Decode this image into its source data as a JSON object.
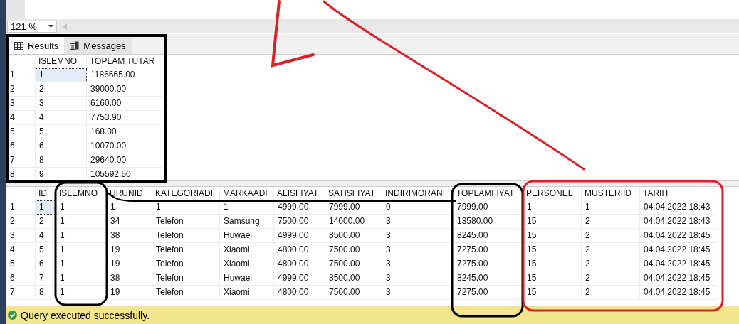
{
  "zoom": {
    "value": "121 %"
  },
  "tabs": [
    {
      "label": "Results",
      "selected": true
    },
    {
      "label": "Messages",
      "selected": false
    }
  ],
  "grid_1": {
    "columns": [
      "ISLEMNO",
      "TOPLAM TUTAR"
    ],
    "rows": [
      {
        "num": "1",
        "selected": true,
        "cells": [
          "1",
          "1186665.00"
        ]
      },
      {
        "num": "2",
        "selected": false,
        "cells": [
          "2",
          "39000.00"
        ]
      },
      {
        "num": "3",
        "selected": false,
        "cells": [
          "3",
          "6160.00"
        ]
      },
      {
        "num": "4",
        "selected": false,
        "cells": [
          "4",
          "7753.90"
        ]
      },
      {
        "num": "5",
        "selected": false,
        "cells": [
          "5",
          "168.00"
        ]
      },
      {
        "num": "6",
        "selected": false,
        "cells": [
          "6",
          "10070.00"
        ]
      },
      {
        "num": "7",
        "selected": false,
        "cells": [
          "8",
          "29640.00"
        ]
      },
      {
        "num": "8",
        "selected": false,
        "cells": [
          "9",
          "105592.50"
        ]
      }
    ]
  },
  "grid_2": {
    "columns": [
      "ID",
      "ISLEMNO",
      "URUNID",
      "KATEGORIADI",
      "MARKAADI",
      "ALISFIYAT",
      "SATISFIYAT",
      "INDIRIMORANI",
      "TOPLAMFIYAT",
      "PERSONEL",
      "MUSTERIID",
      "TARIH"
    ],
    "rows": [
      {
        "num": "1",
        "selected": true,
        "cells": [
          "1",
          "1",
          "1",
          "1",
          "1",
          "4999.00",
          "7999.00",
          "0",
          "7999.00",
          "1",
          "1",
          "04.04.2022 18:43"
        ]
      },
      {
        "num": "2",
        "selected": false,
        "cells": [
          "2",
          "1",
          "34",
          "Telefon",
          "Samsung",
          "7500.00",
          "14000.00",
          "3",
          "13580.00",
          "15",
          "2",
          "04.04.2022 18:43"
        ]
      },
      {
        "num": "3",
        "selected": false,
        "cells": [
          "4",
          "1",
          "38",
          "Telefon",
          "Huwaei",
          "4999.00",
          "8500.00",
          "3",
          "8245.00",
          "15",
          "2",
          "04.04.2022 18:45"
        ]
      },
      {
        "num": "4",
        "selected": false,
        "cells": [
          "5",
          "1",
          "19",
          "Telefon",
          "Xiaomi",
          "4800.00",
          "7500.00",
          "3",
          "7275.00",
          "15",
          "2",
          "04.04.2022 18:45"
        ]
      },
      {
        "num": "5",
        "selected": false,
        "cells": [
          "6",
          "1",
          "19",
          "Telefon",
          "Xiaomi",
          "4800.00",
          "7500.00",
          "3",
          "7275.00",
          "15",
          "2",
          "04.04.2022 18:45"
        ]
      },
      {
        "num": "6",
        "selected": false,
        "cells": [
          "7",
          "1",
          "38",
          "Telefon",
          "Huwaei",
          "4999.00",
          "8500.00",
          "3",
          "8245.00",
          "15",
          "2",
          "04.04.2022 18:45"
        ]
      },
      {
        "num": "7",
        "selected": false,
        "cells": [
          "8",
          "1",
          "19",
          "Telefon",
          "Xiaomi",
          "4800.00",
          "7500.00",
          "3",
          "7275.00",
          "15",
          "2",
          "04.04.2022 18:45"
        ]
      }
    ]
  },
  "status_bar": {
    "text": "Query executed successfully."
  }
}
